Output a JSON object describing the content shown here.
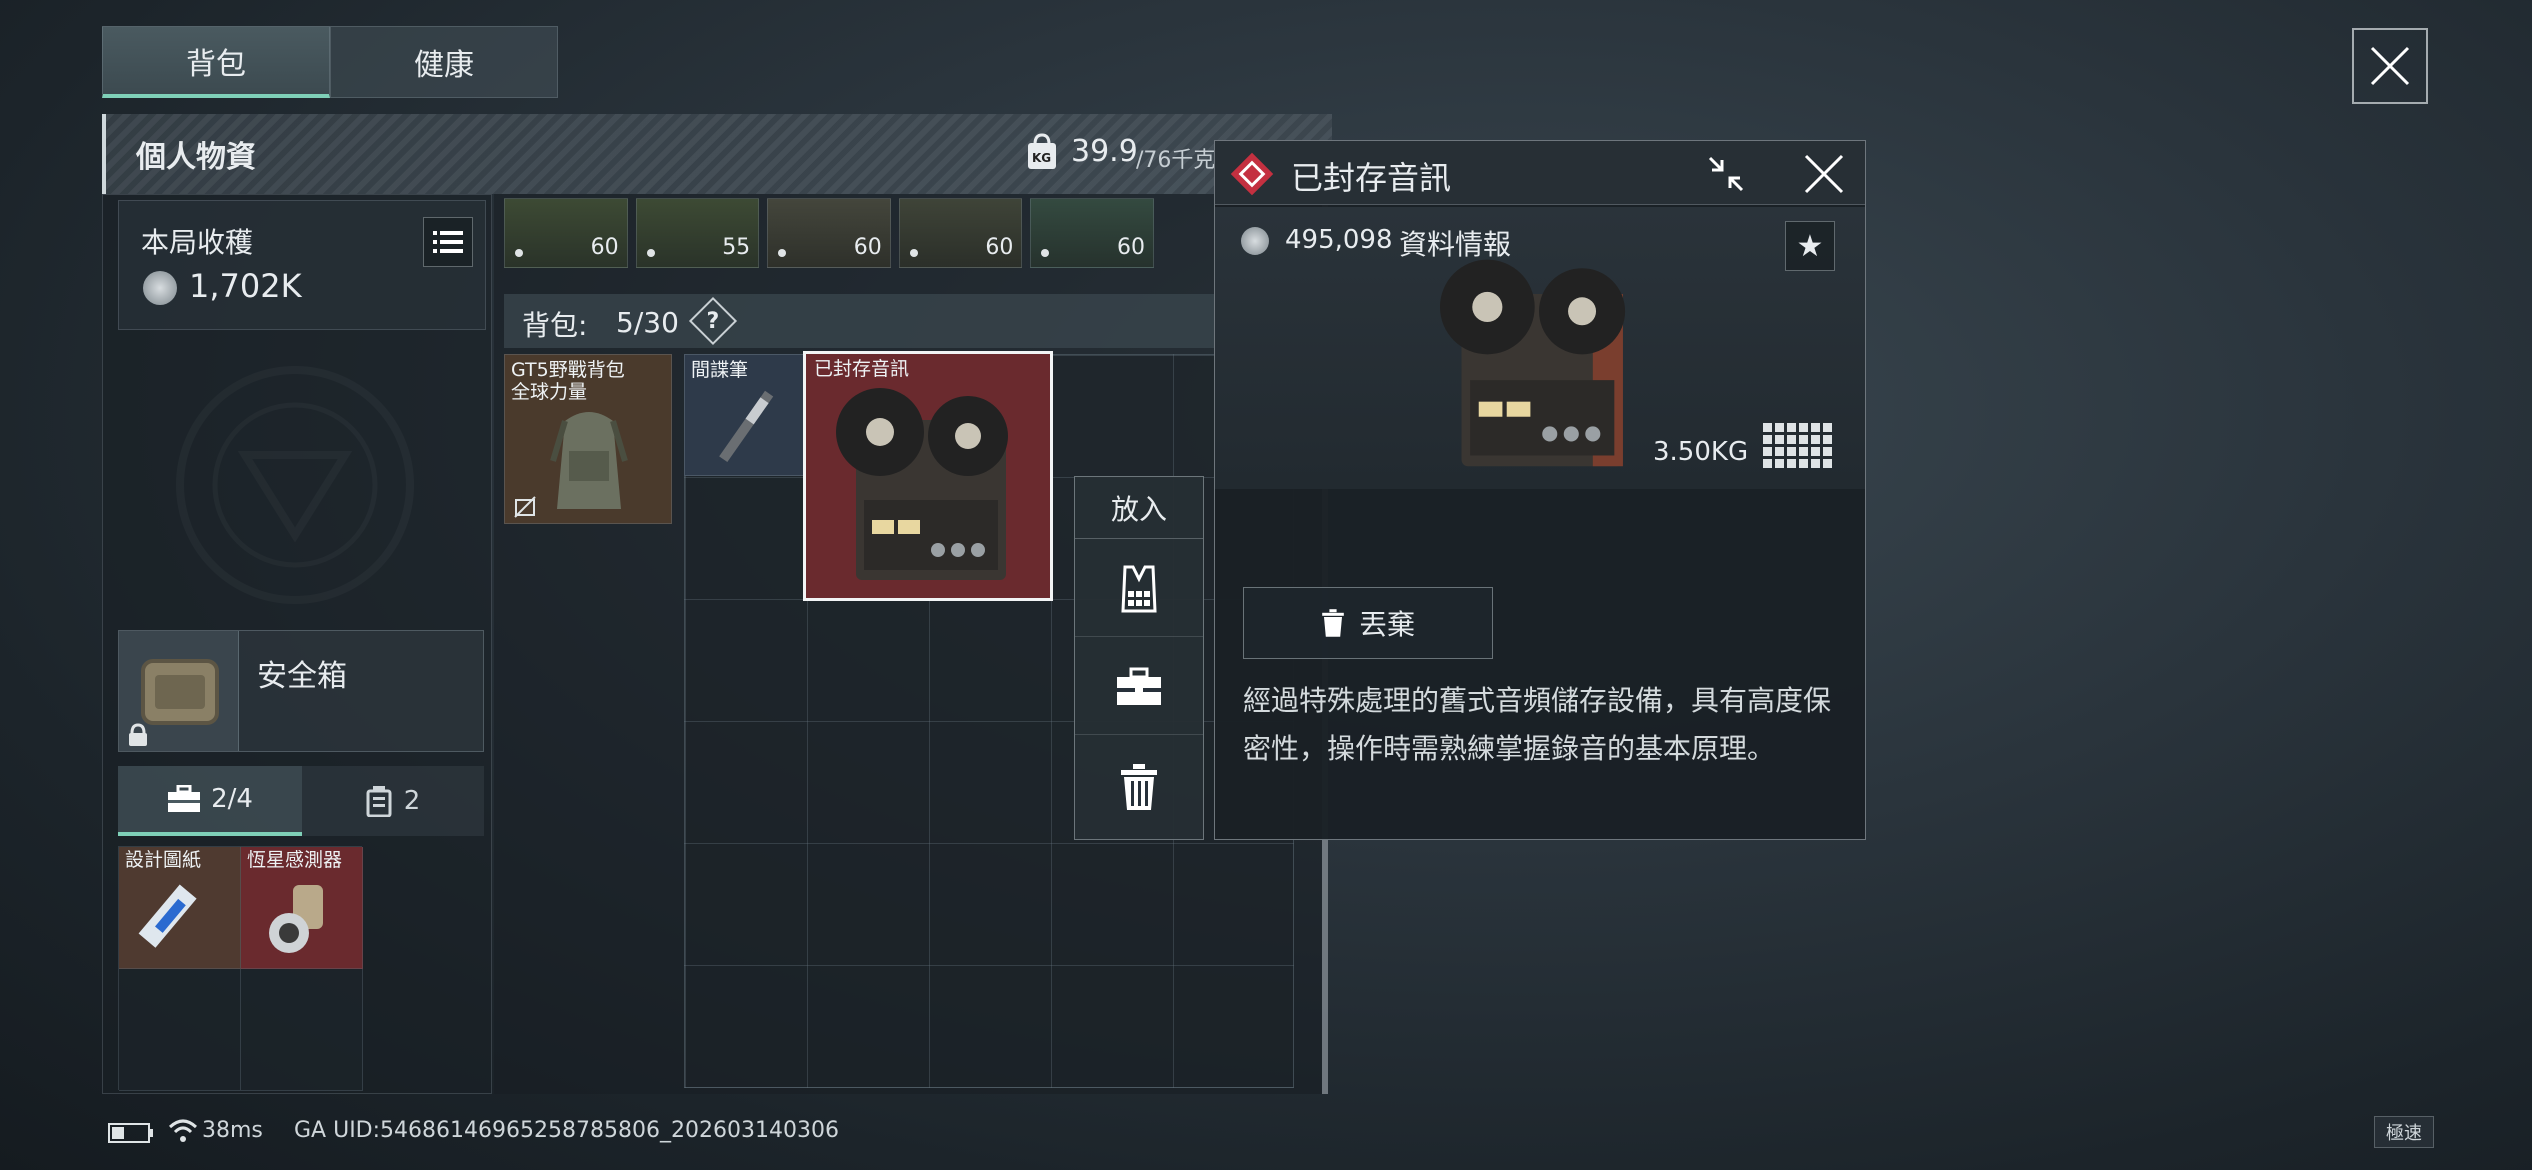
{
  "tabs": [
    {
      "label": "背包"
    },
    {
      "label": "健康"
    }
  ],
  "personal": {
    "title": "個人物資",
    "weight_current": "39.9",
    "weight_max": "/76千克",
    "kg_badge": "KG"
  },
  "harvest": {
    "title": "本局收穫",
    "value": "1,702K"
  },
  "top_slots": [
    {
      "count": "60"
    },
    {
      "count": "55"
    },
    {
      "count": "60"
    },
    {
      "count": "60"
    },
    {
      "count": "60"
    }
  ],
  "backpack": {
    "label": "背包:",
    "capacity": "5/30",
    "help": "?"
  },
  "items": [
    {
      "name": "GT5野戰背包",
      "sub": "全球力量"
    },
    {
      "name": "間諜筆"
    },
    {
      "name": "已封存音訊"
    }
  ],
  "safebox": {
    "label": "安全箱"
  },
  "sub_tabs": [
    {
      "value": "2/4"
    },
    {
      "value": "2"
    }
  ],
  "safebox_items": [
    {
      "name": "設計圖紙"
    },
    {
      "name": "恆星感測器"
    }
  ],
  "put_menu": {
    "title": "放入"
  },
  "detail": {
    "title": "已封存音訊",
    "value": "495,098",
    "info_label": "資料情報",
    "weight": "3.50KG",
    "discard_label": "丟棄",
    "description": "經過特殊處理的舊式音頻儲存設備，具有高度保密性，操作時需熟練掌握錄音的基本原理。"
  },
  "status": {
    "ping": "38ms",
    "uid": "GA UID:54686146965258785806_202603140306",
    "speed": "極速"
  },
  "colors": {
    "accent": "#7fd0b8",
    "rare_red": "#c43040",
    "selected_bg": "#6a2a2e"
  }
}
